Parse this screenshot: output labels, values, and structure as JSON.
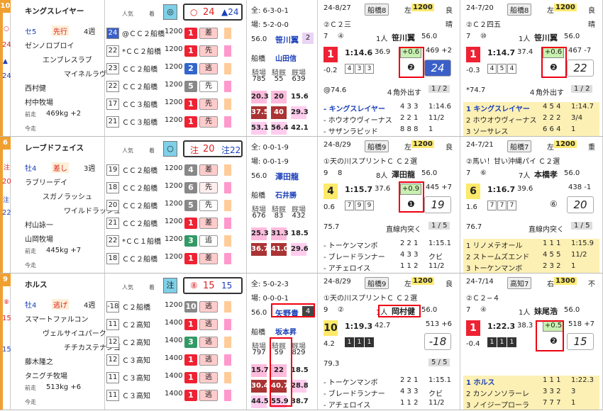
{
  "horses": [
    {
      "num": "10",
      "color": "#f0a030",
      "mark_side": "○",
      "mark_num": "24",
      "mark_tri": "▲",
      "mark_num2": "24",
      "name": "キングスレイヤー",
      "sex_age": "セ5",
      "style": "先行",
      "weeks": "4週",
      "sire": "ゼンノロブロイ",
      "dam": "エンブレスラブ",
      "damsire": "マイネルラヴ",
      "trainer": "西村健",
      "farm": "村中牧場",
      "weight_label": "前走",
      "weight": "469kg +2",
      "today_label": "今走",
      "pop_label": "人気",
      "rank_label": "着",
      "top_mark": "◎",
      "top_mark1": "○",
      "top_mark1_num": "24",
      "top_mark2": "▲24",
      "history": [
        {
          "n": "24",
          "t": "@ＣＣ２船橋",
          "d": "1200",
          "p": "1",
          "pc": "#e23",
          "tag": "差",
          "tc": "#fcc"
        },
        {
          "n": "22",
          "t": "*ＣＣ２船橋",
          "d": "1200",
          "p": "1",
          "pc": "#e23",
          "tag": "先",
          "tc": "#fcc"
        },
        {
          "n": "23",
          "t": "ＣＣ２船橋",
          "d": "1200",
          "p": "2",
          "pc": "#36c",
          "tag": "逃",
          "tc": "#fcc"
        },
        {
          "n": "22",
          "t": "ＣＣ２船橋",
          "d": "1200",
          "p": "5",
          "pc": "#888",
          "tag": "先",
          "tc": "#fff"
        },
        {
          "n": "17",
          "t": "ＣＣ３船橋",
          "d": "1200",
          "p": "1",
          "pc": "#e23",
          "tag": "先",
          "tc": "#fcc"
        },
        {
          "n": "21",
          "t": "ＣＣ３船橋",
          "d": "1200",
          "p": "1",
          "pc": "#e23",
          "tag": "先",
          "tc": "#fcc"
        }
      ],
      "record_all": "全: 6-3-0-1",
      "record_place": "場: 5-2-0-0",
      "jockey_wt": "56.0",
      "jockey": "笹川翼",
      "jockey_num": "2",
      "track": "船橋",
      "trainer2": "山田信",
      "stat_heads": [
        "騎場",
        "騎厩",
        "厩場"
      ],
      "stat_vals": [
        "785",
        "55",
        "639"
      ],
      "stat_rows": [
        [
          "20.3",
          "20",
          "15.6"
        ],
        [
          "37.5",
          "40",
          "29.3"
        ],
        [
          "53.1",
          "56.4",
          "42.1"
        ]
      ],
      "r1": {
        "date": "24-8/27",
        "track": "船橋8",
        "turn": "左",
        "dist": "1200",
        "cond": "良",
        "race": "②Ｃ２三",
        "weather": "晴",
        "fld": "7",
        "gate": "④",
        "rankno": "1人",
        "jockey": "笹川翼",
        "wt": "56.0",
        "pos": "1",
        "time": "1:14.6",
        "t3": "36.9",
        "diff": "+0.6",
        "bw": "469 +2",
        "margin": "-0.2",
        "corners": [
          "4",
          "3",
          "3"
        ],
        "big": "24",
        "agari": "❷",
        "note": "@74.6",
        "note2": "４角外出す",
        "frac": "1 / 2",
        "rivals": [
          [
            "キングスレイヤー",
            "4 3 3",
            "1:14.6"
          ],
          [
            "ホウオウヴィーナス",
            "2 2 1",
            "11/2"
          ],
          [
            "サザンラピッド",
            "8 8 8",
            "1"
          ]
        ]
      },
      "r2": {
        "date": "24-7/20",
        "track": "船橋8",
        "turn": "左",
        "dist": "1200",
        "cond": "良",
        "race": "②Ｃ２四五",
        "weather": "晴",
        "fld": "7",
        "gate": "⑩",
        "rankno": "1人",
        "jockey": "笹川翼",
        "wt": "56.0",
        "pos": "1",
        "time": "1:14.7",
        "t3": "37.4",
        "diff": "+0.6",
        "bw": "467 -7",
        "margin": "-0.3",
        "corners": [
          "4",
          "5",
          "4"
        ],
        "big": "22",
        "agari": "❷",
        "note": "*74.7",
        "note2": "４角外出す",
        "frac": "1 / 2",
        "rivals": [
          [
            "キングスレイヤー",
            "4 5 4",
            "1:14.7"
          ],
          [
            "ホウオウヴィーナス",
            "2 2 2",
            "3/4"
          ],
          [
            "ソーサレス",
            "6 6 4",
            "1"
          ]
        ]
      }
    },
    {
      "num": "6",
      "color": "#f0a030",
      "mark_side": "注",
      "mark_num": "20",
      "mark_tri": "注",
      "mark_num2": "22",
      "name": "レーブドフェイス",
      "sex_age": "牡4",
      "style": "差し",
      "weeks": "3週",
      "sire": "ラブリーデイ",
      "dam": "スガノラッシュ",
      "damsire": "ワイルドラッシュ",
      "trainer": "村山詠一",
      "farm": "山岡牧場",
      "weight_label": "前走",
      "weight": "445kg +7",
      "today_label": "今走",
      "pop_label": "人気",
      "rank_label": "着",
      "top_mark": "○",
      "top_mark1": "注",
      "top_mark1_num": "20",
      "top_mark2": "注22",
      "history": [
        {
          "n": "19",
          "t": "ＣＣ２船橋",
          "d": "1200",
          "p": "4",
          "pc": "#888",
          "tag": "差",
          "tc": "#fcc"
        },
        {
          "n": "18",
          "t": "ＣＣ２船橋",
          "d": "1200",
          "p": "6",
          "pc": "#888",
          "tag": "先",
          "tc": "#fee"
        },
        {
          "n": "20",
          "t": "ＣＣ２船橋",
          "d": "1200",
          "p": "5",
          "pc": "#888",
          "tag": "先",
          "tc": "#fff"
        },
        {
          "n": "21",
          "t": "ＣＣ２船橋",
          "d": "1200",
          "p": "1",
          "pc": "#e23",
          "tag": "差",
          "tc": "#fcc"
        },
        {
          "n": "22",
          "t": "*ＣＣ１船橋",
          "d": "1200",
          "p": "3",
          "pc": "#396",
          "tag": "追",
          "tc": "#fff"
        },
        {
          "n": "18",
          "t": "ＣＣ２船橋",
          "d": "1200",
          "p": "1",
          "pc": "#e23",
          "tag": "差",
          "tc": "#fcc"
        }
      ],
      "record_all": "全: 0-0-1-9",
      "record_place": "場: 0-0-1-9",
      "jockey_wt": "56.0",
      "jockey": "澤田龍",
      "jockey_num": "",
      "track": "船橋",
      "trainer2": "石井勝",
      "stat_heads": [
        "騎場",
        "騎厩",
        "厩場"
      ],
      "stat_vals": [
        "676",
        "83",
        "432"
      ],
      "stat_rows": [
        [
          "25.3",
          "31.3",
          "18.5"
        ],
        [
          "36.7",
          "41.0",
          "29.6"
        ],
        [
          "",
          "",
          ""
        ]
      ],
      "r1": {
        "date": "24-8/29",
        "track": "船橋9",
        "turn": "左",
        "dist": "1200",
        "cond": "良",
        "race": "①天の川スプリントＣ Ｃ２選",
        "weather": "",
        "fld": "9",
        "gate": "8",
        "rankno": "8人",
        "jockey": "澤田龍",
        "wt": "56.0",
        "pos": "4",
        "time": "1:15.7",
        "t3": "37.6",
        "diff": "+0.9",
        "bw": "445 +7",
        "margin": "0.6",
        "corners": [
          "7",
          "9",
          "9"
        ],
        "big": "19",
        "agari": "❶",
        "note": "75.7",
        "note2": "直線内突く",
        "frac": "1 / 5",
        "rivals": [
          [
            "トーケンマンボ",
            "2 2 1",
            "1:15.1"
          ],
          [
            "ブレードランナー",
            "4 3 3",
            "クビ"
          ],
          [
            "アチェロイス",
            "1 1 2",
            "11/2"
          ]
        ]
      },
      "r2": {
        "date": "24-7/21",
        "track": "船橋7",
        "turn": "左",
        "dist": "1200",
        "cond": "重",
        "race": "②馬い！甘い沖縄パイ Ｃ２選",
        "weather": "",
        "fld": "7",
        "gate": "⑥",
        "rankno": "7人",
        "jockey": "本橋孝",
        "wt": "56.0",
        "pos": "6",
        "time": "1:16.7",
        "t3": "39.6",
        "diff": "",
        "bw": "438 -1",
        "margin": "1.6",
        "corners": [
          "7",
          "7",
          "7"
        ],
        "big": "20",
        "agari": "⑥",
        "note": "76.7",
        "note2": "直線内突く",
        "frac": "1 / 5",
        "rivals": [
          [
            "リノメテオール",
            "1 1 1",
            "1:15.9"
          ],
          [
            "ストームズエンド",
            "4 5 5",
            "11/2"
          ],
          [
            "トーケンマンボ",
            "2 3 2",
            "1"
          ]
        ]
      }
    },
    {
      "num": "9",
      "color": "#f0a030",
      "mark_side": "⑧",
      "mark_num": "15",
      "mark_tri": "",
      "mark_num2": "15",
      "name": "ホルス",
      "sex_age": "牡4",
      "style": "逃げ",
      "weeks": "4週",
      "sire": "スマートファルコン",
      "dam": "ヴェルサイユパーク",
      "damsire": "チチカステナンゴ",
      "trainer": "藤木隆之",
      "farm": "タニグチ牧場",
      "weight_label": "前走",
      "weight": "513kg +6",
      "today_label": "今走",
      "pop_label": "人気",
      "rank_label": "着",
      "top_mark": "注",
      "top_mark1": "⑧",
      "top_mark1_num": "15",
      "top_mark2": "15",
      "history": [
        {
          "n": "-18",
          "t": "Ｃ２船橋",
          "d": "1200",
          "p": "10",
          "pc": "#888",
          "tag": "逃",
          "tc": "#fcc"
        },
        {
          "n": "11",
          "t": "Ｃ２高知",
          "d": "1400",
          "p": "1",
          "pc": "#e23",
          "tag": "逃",
          "tc": "#fcc"
        },
        {
          "n": "12",
          "t": "Ｃ２高知",
          "d": "1400",
          "p": "3",
          "pc": "#396",
          "tag": "逃",
          "tc": "#fcc"
        },
        {
          "n": "12",
          "t": "Ｃ３高知",
          "d": "1400",
          "p": "1",
          "pc": "#e23",
          "tag": "逃",
          "tc": "#fcc"
        },
        {
          "n": "11",
          "t": "Ｃ３高知",
          "d": "1400",
          "p": "1",
          "pc": "#e23",
          "tag": "逃",
          "tc": "#fcc"
        },
        {
          "n": "11",
          "t": "Ｃ３高知",
          "d": "1400",
          "p": "1",
          "pc": "#e23",
          "tag": "逃",
          "tc": "#fcc"
        }
      ],
      "record_all": "全: 5-0-2-3",
      "record_place": "場: 0-0-0-1",
      "jockey_wt": "56.0",
      "jockey": "矢野貴",
      "jockey_num": "4",
      "track": "船橋",
      "trainer2": "坂本昇",
      "stat_heads": [
        "騎場",
        "騎厩",
        "厩場"
      ],
      "stat_vals": [
        "797",
        "59",
        "829"
      ],
      "stat_rows": [
        [
          "15.7",
          "22",
          "18.5"
        ],
        [
          "30.4",
          "40.7",
          "28.8"
        ],
        [
          "44.5",
          "55.9",
          "38.7"
        ]
      ],
      "r1": {
        "date": "24-8/29",
        "track": "船橋9",
        "turn": "左",
        "dist": "1200",
        "cond": "良",
        "race": "①天の川スプリントＣ Ｃ２選",
        "weather": "",
        "fld": "9",
        "gate": "②",
        "rankno": "1人",
        "jockey": "岡村健",
        "wt": "56.0",
        "pos": "10",
        "time": "1:19.3",
        "t3": "42.7",
        "diff": "",
        "bw": "513 +6",
        "margin": "4.2",
        "corners": [
          "1",
          "1",
          "1"
        ],
        "big": "-18",
        "agari": "",
        "note": "79.3",
        "note2": "",
        "frac": "5 / 5",
        "rivals": [
          [
            "トーケンマンボ",
            "2 2 1",
            "1:15.1"
          ],
          [
            "ブレードランナー",
            "4 3 3",
            "クビ"
          ],
          [
            "アチェロイス",
            "1 1 2",
            "11/2"
          ]
        ]
      },
      "r2": {
        "date": "24-7/14",
        "track": "高知7",
        "turn": "右",
        "dist": "1300",
        "cond": "不",
        "race": "②Ｃ２−４",
        "weather": "",
        "fld": "7",
        "gate": "④",
        "rankno": "1人",
        "jockey": "妹尾浩",
        "wt": "56.0",
        "pos": "1",
        "time": "1:22.3",
        "t3": "38.3",
        "diff": "+0.5",
        "bw": "518 +7",
        "margin": "-0.4",
        "corners": [
          "1",
          "1",
          "1"
        ],
        "big": "15",
        "agari": "❷",
        "note": "",
        "note2": "",
        "frac": "",
        "rivals": [
          [
            "ホルス",
            "1 1 1",
            "1:22.3"
          ],
          [
            "カンノンソラーレ",
            "3 3 2",
            "3"
          ],
          [
            "ノイジープローラ",
            "7 7 7",
            "1"
          ]
        ]
      }
    }
  ]
}
